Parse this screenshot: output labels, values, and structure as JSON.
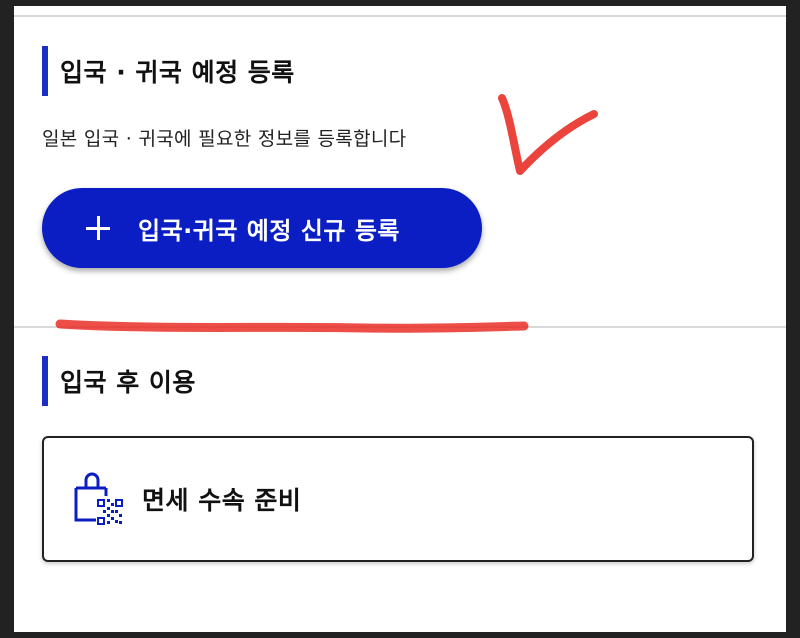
{
  "section_register": {
    "heading": "입국 · 귀국 예정 등록",
    "description": "일본 입국 · 귀국에 필요한 정보를 등록합니다",
    "button_label": "입국·귀국 예정 신규 등록",
    "button_icon": "plus-icon"
  },
  "section_after_entry": {
    "heading": "입국 후 이용",
    "card": {
      "label": "면세 수속 준비",
      "icon": "shopping-bag-qr-icon"
    }
  },
  "colors": {
    "accent": "#0a1ec4",
    "heading_bar": "#1a2fc4",
    "annotation": "#e8231a",
    "divider": "#d9d9d9"
  }
}
